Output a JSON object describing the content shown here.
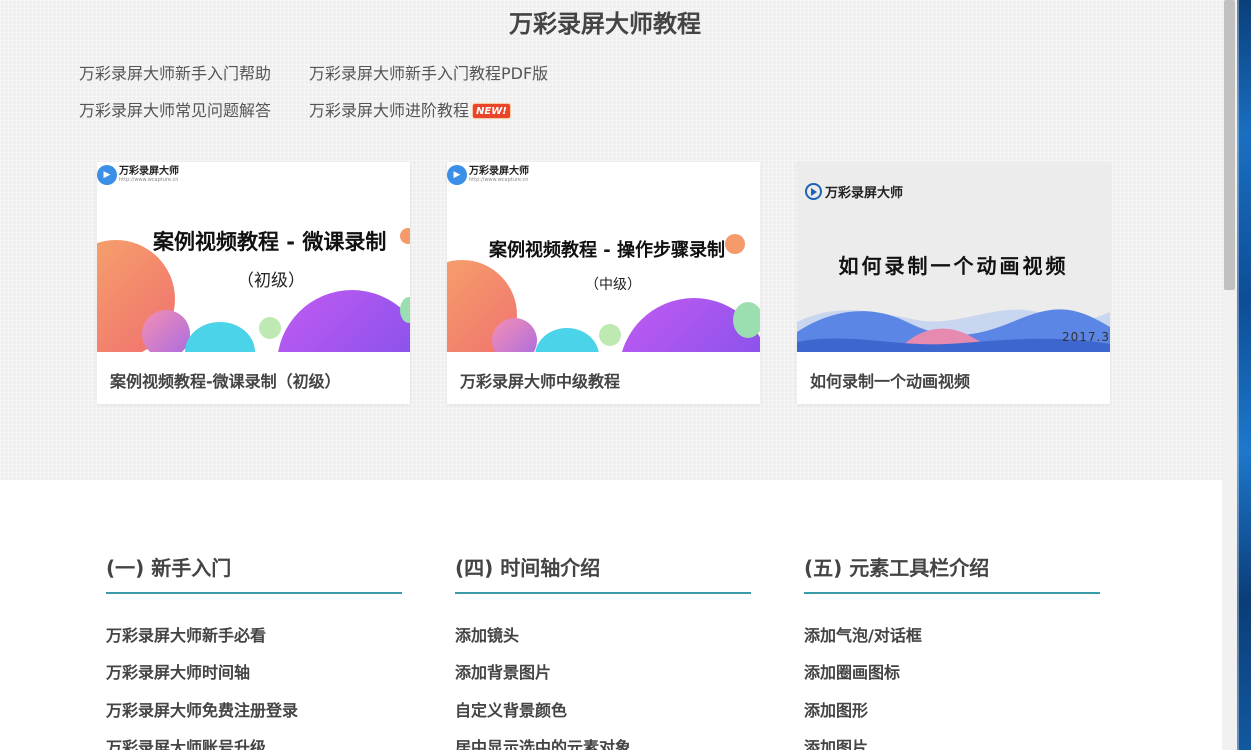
{
  "page": {
    "title": "万彩录屏大师教程"
  },
  "help_links": {
    "beginner_help": "万彩录屏大师新手入门帮助",
    "beginner_pdf": "万彩录屏大师新手入门教程PDF版",
    "faq": "万彩录屏大师常见问题解答",
    "advanced": "万彩录屏大师进阶教程",
    "new_badge": "NEW!"
  },
  "cards": [
    {
      "caption": "案例视频教程-微课录制（初级）",
      "thumb_brand": "万彩录屏大师",
      "thumb_url": "http://www.wcapture.cn",
      "thumb_title": "案例视频教程 - 微课录制",
      "thumb_sub": "（初级）"
    },
    {
      "caption": "万彩录屏大师中级教程",
      "thumb_brand": "万彩录屏大师",
      "thumb_url": "http://www.wcapture.cn",
      "thumb_title": "案例视频教程 - 操作步骤录制",
      "thumb_sub": "（中级）"
    },
    {
      "caption": "如何录制一个动画视频",
      "thumb_brand": "万彩录屏大师",
      "thumb_title": "如何录制一个动画视频",
      "thumb_date": "2017.3"
    }
  ],
  "columns": [
    {
      "heading": "(一) 新手入门",
      "items": [
        "万彩录屏大师新手必看",
        "万彩录屏大师时间轴",
        "万彩录屏大师免费注册登录",
        "万彩录屏大师账号升级"
      ]
    },
    {
      "heading": "(四) 时间轴介绍",
      "items": [
        "添加镜头",
        "添加背景图片",
        "自定义背景颜色",
        "居中显示选中的元素对象"
      ]
    },
    {
      "heading": "(五) 元素工具栏介绍",
      "items": [
        "添加气泡/对话框",
        "添加圈画图标",
        "添加图形",
        "添加图片"
      ]
    }
  ],
  "colors": {
    "accent_rule": "#3c9ba8",
    "new_badge": "#e8452b"
  }
}
